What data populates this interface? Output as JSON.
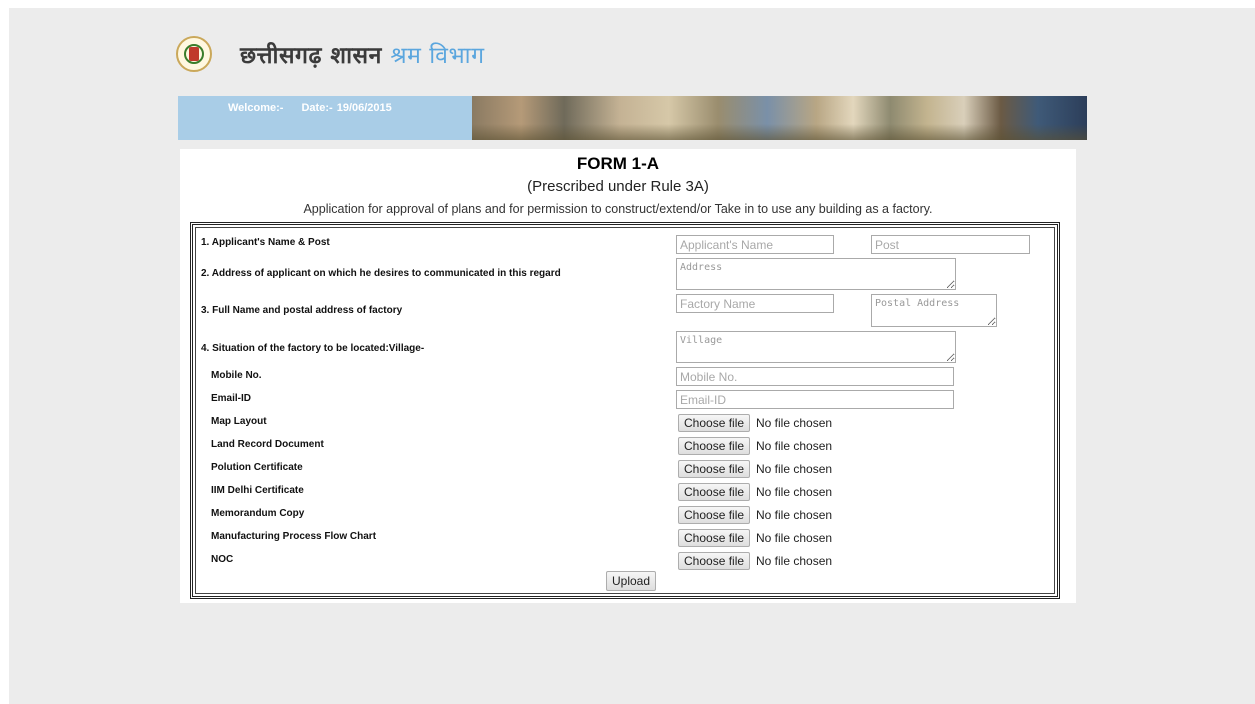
{
  "header": {
    "gov_text": "छत्तीसगढ़ शासन",
    "dept_text": "श्रम विभाग"
  },
  "banner": {
    "welcome": "Welcome:-",
    "date": "Date:- 19/06/2015"
  },
  "form": {
    "title": "FORM 1-A",
    "subtitle": "(Prescribed under Rule 3A)",
    "description": "Application for approval of plans and for permission to construct/extend/or Take in to use any building as a factory."
  },
  "fields": {
    "applicant_label": "1. Applicant's Name & Post",
    "applicant_name_placeholder": "Applicant's Name",
    "post_placeholder": "Post",
    "address_label": "2. Address of applicant on which he desires to communicated in this regard",
    "address_placeholder": "Address",
    "factory_label": "3. Full Name and postal address of factory",
    "factory_name_placeholder": "Factory Name",
    "postal_address_placeholder": "Postal Address",
    "situation_label": "4. Situation of the factory to be located:Village-",
    "village_placeholder": "Village",
    "mobile_label": "Mobile No.",
    "mobile_placeholder": "Mobile No.",
    "email_label": "Email-ID",
    "email_placeholder": "Email-ID"
  },
  "uploads": [
    {
      "label": "Map Layout",
      "button": "Choose file",
      "status": "No file chosen"
    },
    {
      "label": "Land Record Document",
      "button": "Choose file",
      "status": "No file chosen"
    },
    {
      "label": "Polution Certificate",
      "button": "Choose file",
      "status": "No file chosen"
    },
    {
      "label": "IIM Delhi Certificate",
      "button": "Choose file",
      "status": "No file chosen"
    },
    {
      "label": "Memorandum Copy",
      "button": "Choose file",
      "status": "No file chosen"
    },
    {
      "label": "Manufacturing Process Flow Chart",
      "button": "Choose file",
      "status": "No file chosen"
    },
    {
      "label": "NOC",
      "button": "Choose file",
      "status": "No file chosen"
    }
  ],
  "upload_button": "Upload",
  "colors": {
    "banner": "#a9cde7",
    "dept_text": "#5ba6de",
    "page_bg": "#ececec"
  }
}
